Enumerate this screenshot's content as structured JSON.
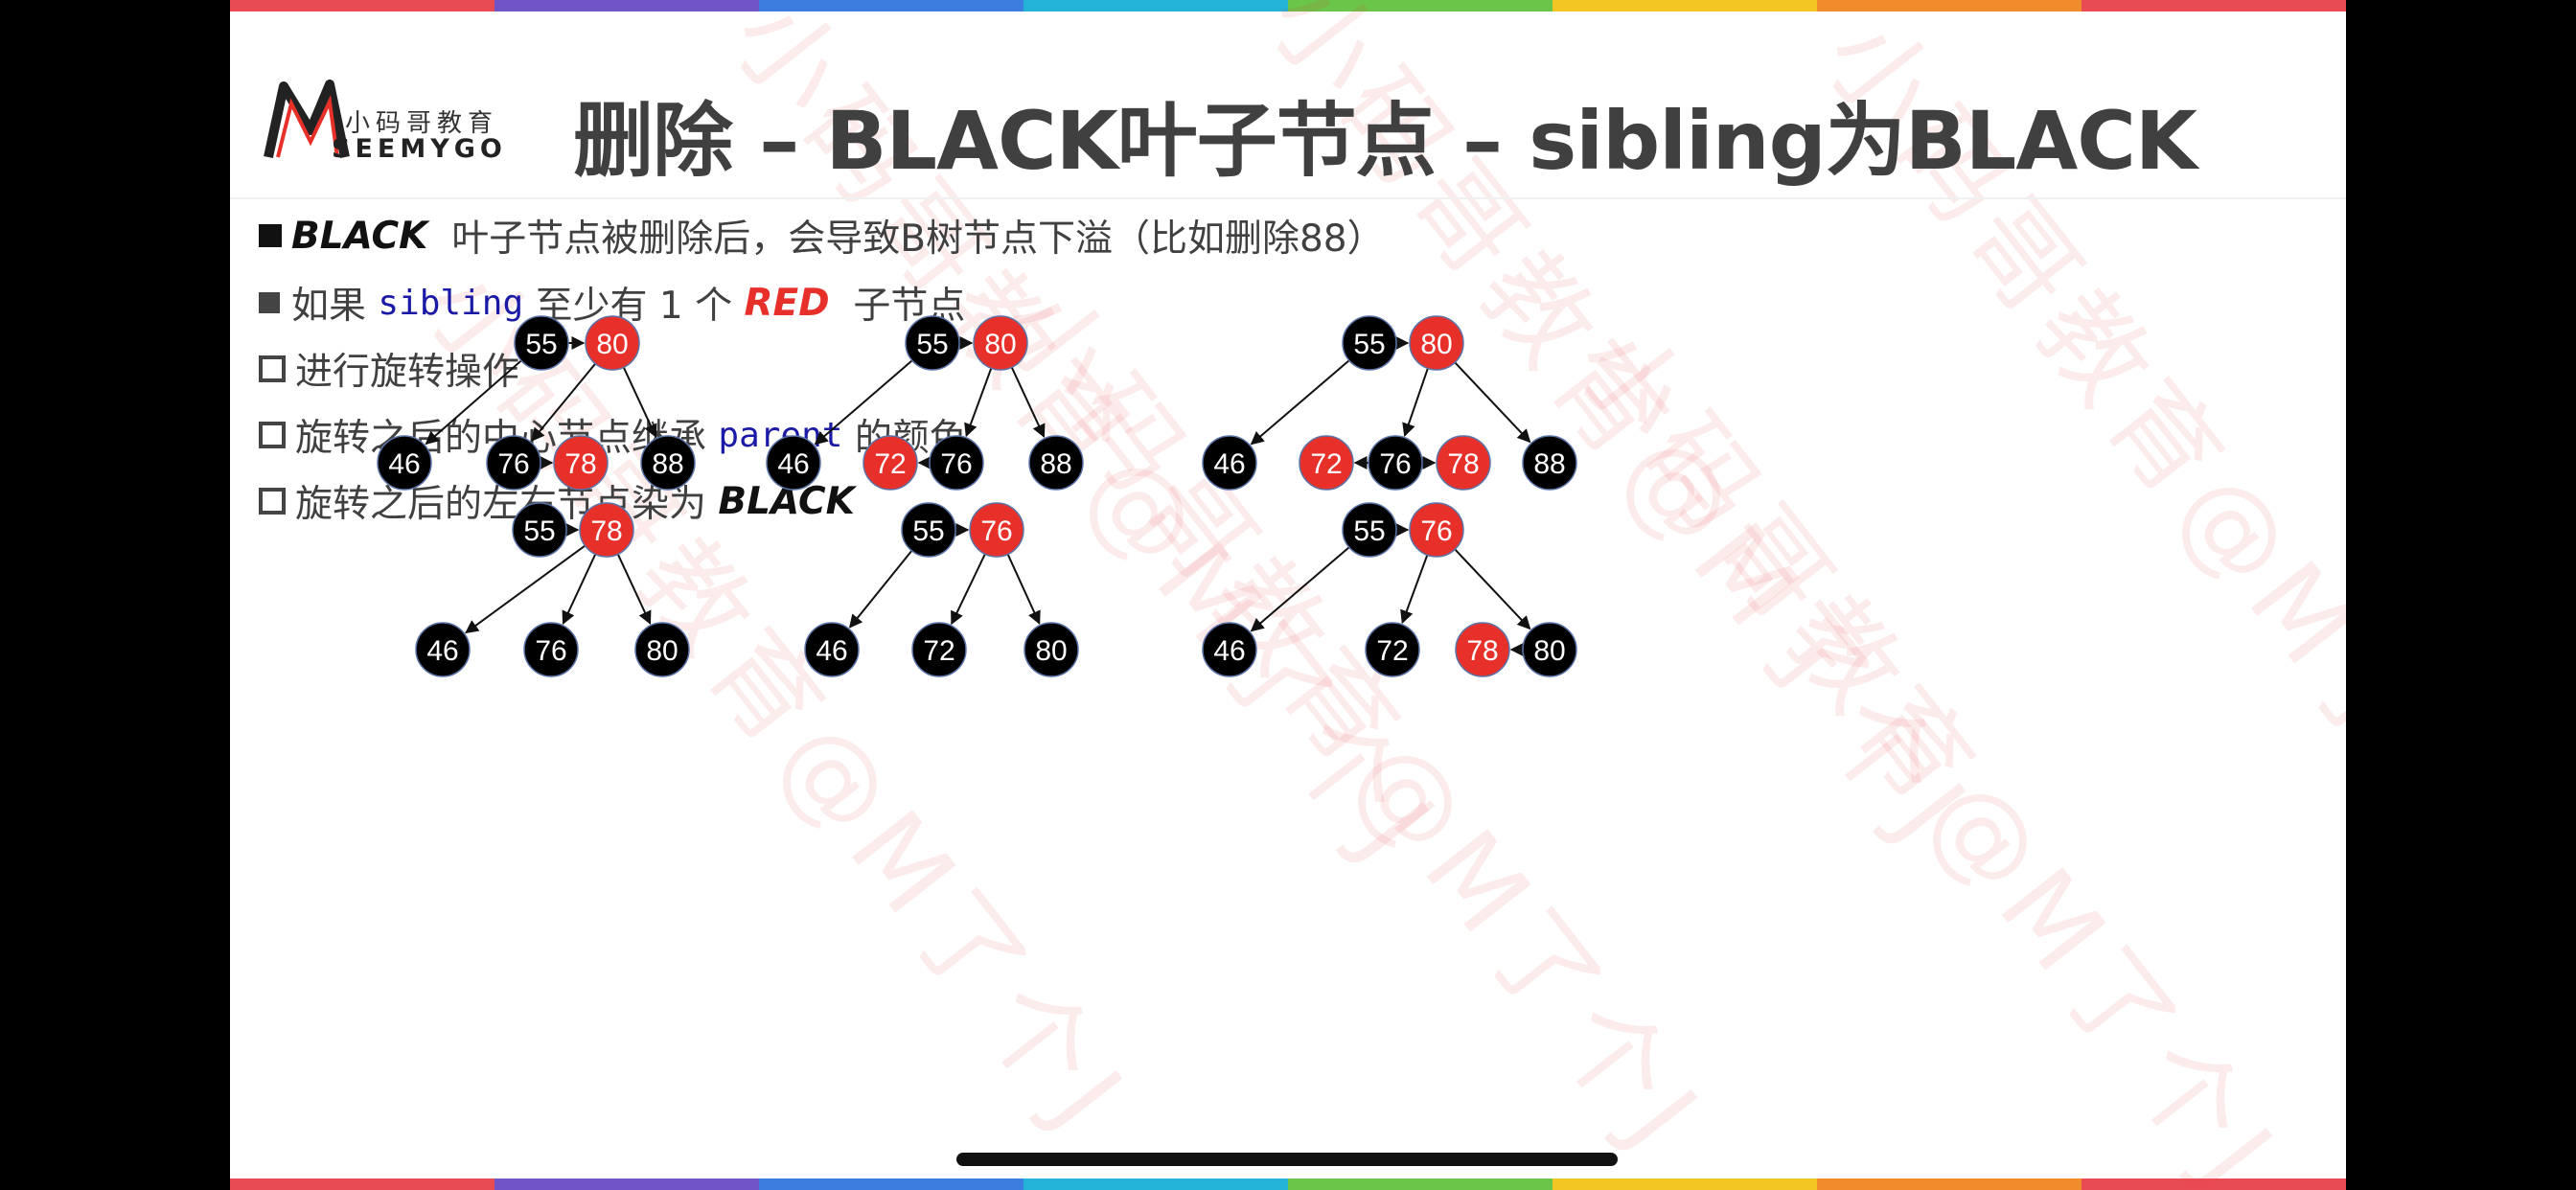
{
  "logo": {
    "cn": "小码哥教育",
    "en": "SEEMYGO"
  },
  "title": "删除 – BLACK叶子节点 – sibling为BLACK",
  "watermark": "小码哥教育@M了个J",
  "bullets": [
    {
      "marker": "filled",
      "parts": [
        {
          "t": "BLACK",
          "s": "bi"
        },
        {
          "t": "  叶子节点被删除后，会导致B树节点下溢（比如删除88）",
          "s": ""
        }
      ]
    },
    {
      "marker": "gray",
      "parts": [
        {
          "t": "如果 ",
          "s": ""
        },
        {
          "t": "sibling",
          "s": "code"
        },
        {
          "t": " 至少有 1 个 ",
          "s": ""
        },
        {
          "t": "RED",
          "s": "bi red"
        },
        {
          "t": "  子节点",
          "s": ""
        }
      ]
    },
    {
      "marker": "hollow",
      "parts": [
        {
          "t": "进行旋转操作",
          "s": ""
        }
      ]
    },
    {
      "marker": "hollow",
      "parts": [
        {
          "t": "旋转之后的中心节点继承 ",
          "s": ""
        },
        {
          "t": "parent",
          "s": "code"
        },
        {
          "t": " 的颜色",
          "s": ""
        }
      ]
    },
    {
      "marker": "hollow",
      "parts": [
        {
          "t": "旋转之后的左右节点染为 ",
          "s": ""
        },
        {
          "t": "BLACK",
          "s": "bi"
        }
      ]
    }
  ],
  "colors": {
    "red": "#e8302a",
    "black": "#000000",
    "stroke": "#5a74a8",
    "stripes": [
      "#e94b55",
      "#7055c9",
      "#3b7ee0",
      "#23b3d6",
      "#6bc548",
      "#f3c623",
      "#f08c2b",
      "#e94b55"
    ]
  },
  "trees": [
    {
      "nodes": [
        {
          "id": "a",
          "v": "55",
          "c": "black"
        },
        {
          "id": "b",
          "v": "80",
          "c": "red"
        },
        {
          "id": "c",
          "v": "46",
          "c": "black"
        },
        {
          "id": "d",
          "v": "76",
          "c": "black"
        },
        {
          "id": "e",
          "v": "78",
          "c": "red"
        },
        {
          "id": "f",
          "v": "88",
          "c": "black"
        }
      ],
      "edges": [
        [
          "a",
          "b"
        ],
        [
          "a",
          "c"
        ],
        [
          "b",
          "d"
        ],
        [
          "d",
          "e"
        ],
        [
          "b",
          "f"
        ]
      ]
    },
    {
      "nodes": [
        {
          "id": "a",
          "v": "55",
          "c": "black"
        },
        {
          "id": "b",
          "v": "80",
          "c": "red"
        },
        {
          "id": "c",
          "v": "46",
          "c": "black"
        },
        {
          "id": "d",
          "v": "72",
          "c": "red"
        },
        {
          "id": "e",
          "v": "76",
          "c": "black"
        },
        {
          "id": "f",
          "v": "88",
          "c": "black"
        }
      ],
      "edges": [
        [
          "a",
          "b"
        ],
        [
          "a",
          "c"
        ],
        [
          "b",
          "e"
        ],
        [
          "e",
          "d"
        ],
        [
          "b",
          "f"
        ]
      ]
    },
    {
      "nodes": [
        {
          "id": "a",
          "v": "55",
          "c": "black"
        },
        {
          "id": "b",
          "v": "80",
          "c": "red"
        },
        {
          "id": "c",
          "v": "46",
          "c": "black"
        },
        {
          "id": "d",
          "v": "72",
          "c": "red"
        },
        {
          "id": "e",
          "v": "76",
          "c": "black"
        },
        {
          "id": "f",
          "v": "78",
          "c": "red"
        },
        {
          "id": "g",
          "v": "88",
          "c": "black"
        }
      ],
      "edges": [
        [
          "a",
          "b"
        ],
        [
          "a",
          "c"
        ],
        [
          "b",
          "e"
        ],
        [
          "e",
          "d"
        ],
        [
          "e",
          "f"
        ],
        [
          "b",
          "g"
        ]
      ]
    },
    {
      "nodes": [
        {
          "id": "a",
          "v": "55",
          "c": "black"
        },
        {
          "id": "b",
          "v": "78",
          "c": "red"
        },
        {
          "id": "c",
          "v": "46",
          "c": "black"
        },
        {
          "id": "d",
          "v": "76",
          "c": "black"
        },
        {
          "id": "e",
          "v": "80",
          "c": "black"
        }
      ],
      "edges": [
        [
          "a",
          "b"
        ],
        [
          "b",
          "c"
        ],
        [
          "b",
          "d"
        ],
        [
          "b",
          "e"
        ]
      ]
    },
    {
      "nodes": [
        {
          "id": "a",
          "v": "55",
          "c": "black"
        },
        {
          "id": "b",
          "v": "76",
          "c": "red"
        },
        {
          "id": "c",
          "v": "46",
          "c": "black"
        },
        {
          "id": "d",
          "v": "72",
          "c": "black"
        },
        {
          "id": "e",
          "v": "80",
          "c": "black"
        }
      ],
      "edges": [
        [
          "a",
          "b"
        ],
        [
          "a",
          "c"
        ],
        [
          "b",
          "d"
        ],
        [
          "b",
          "e"
        ]
      ]
    },
    {
      "nodes": [
        {
          "id": "a",
          "v": "55",
          "c": "black"
        },
        {
          "id": "b",
          "v": "76",
          "c": "red"
        },
        {
          "id": "c",
          "v": "46",
          "c": "black"
        },
        {
          "id": "d",
          "v": "72",
          "c": "black"
        },
        {
          "id": "e",
          "v": "78",
          "c": "red"
        },
        {
          "id": "f",
          "v": "80",
          "c": "black"
        }
      ],
      "edges": [
        [
          "a",
          "b"
        ],
        [
          "a",
          "c"
        ],
        [
          "b",
          "d"
        ],
        [
          "b",
          "f"
        ],
        [
          "f",
          "e"
        ]
      ]
    }
  ]
}
